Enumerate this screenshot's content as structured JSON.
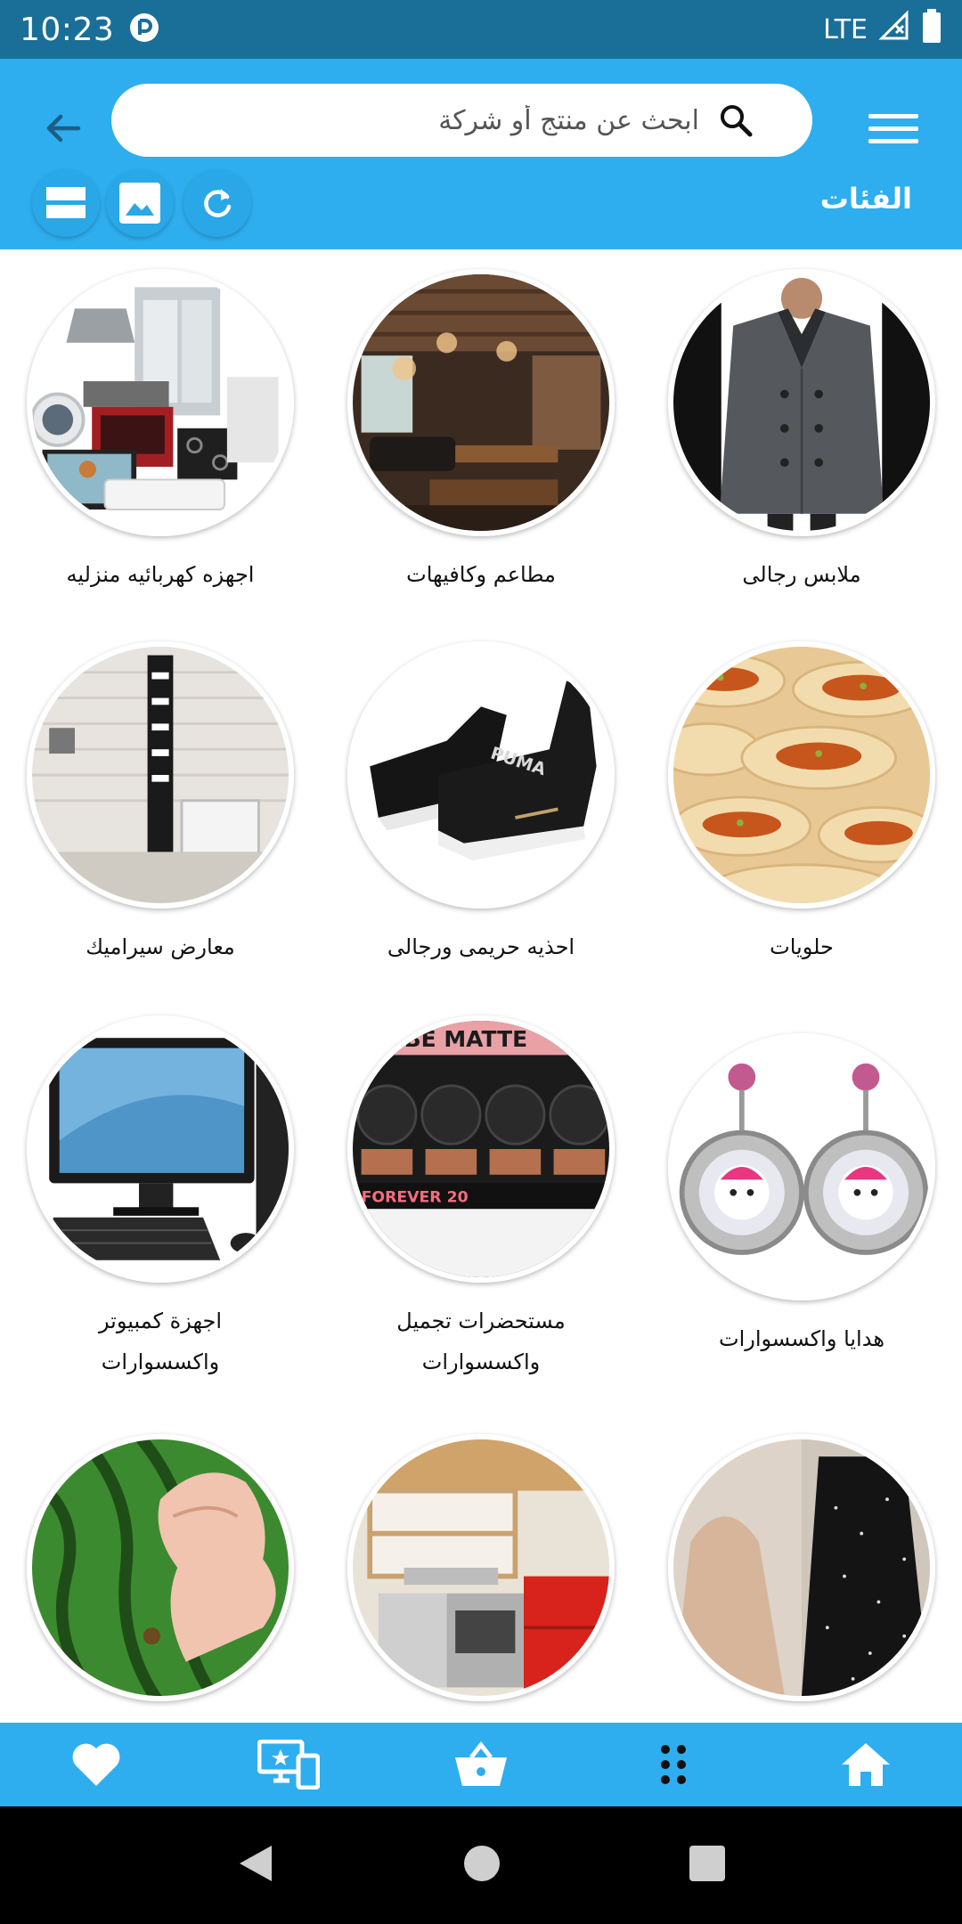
{
  "status_bar": {
    "time": "10:23",
    "network": "LTE"
  },
  "header": {
    "search_placeholder": "ابحث عن منتج أو شركة",
    "categories_title": "الفئات"
  },
  "categories": [
    {
      "label": "ملابس رجالى"
    },
    {
      "label": "مطاعم وكافيهات"
    },
    {
      "label": "اجهزه كهربائيه منزليه"
    },
    {
      "label": "حلويات"
    },
    {
      "label": "احذيه حريمى ورجالى"
    },
    {
      "label": "معارض سيراميك"
    },
    {
      "label": "هدايا واكسسوارات"
    },
    {
      "label": "مستحضرات تجميل واكسسوارات"
    },
    {
      "label": "اجهزة كمبيوتر واكسسوارات"
    },
    {
      "label": ""
    },
    {
      "label": ""
    },
    {
      "label": ""
    }
  ],
  "photo_texts": {
    "shoe_brand": "PUMA",
    "makeup_banner": "BE MATTE",
    "makeup_brand": "FOREVER 20"
  },
  "bottom_nav": [
    {
      "icon": "heart-icon"
    },
    {
      "icon": "devices-icon"
    },
    {
      "icon": "basket-icon"
    },
    {
      "icon": "apps-grid-icon"
    },
    {
      "icon": "home-icon"
    }
  ],
  "colors": {
    "status_bar": "#1a6f98",
    "primary": "#2eaeee",
    "white": "#ffffff"
  }
}
